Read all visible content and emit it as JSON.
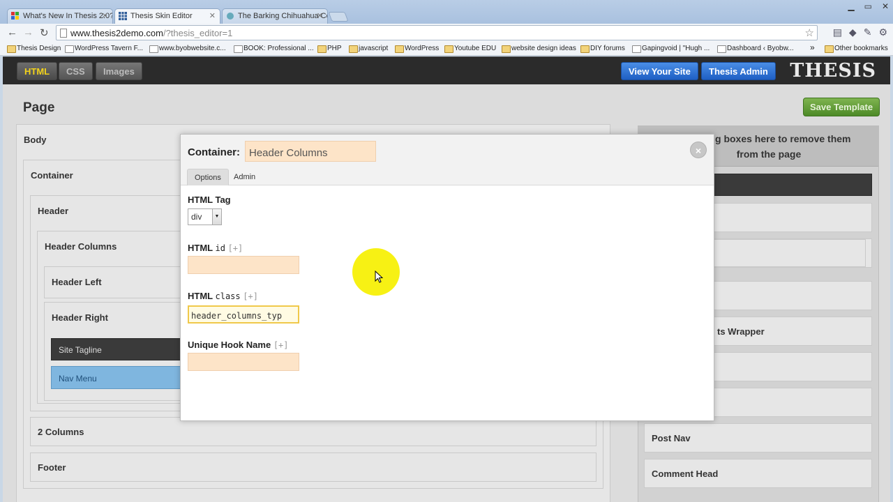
{
  "browser": {
    "tabs": [
      {
        "title": "What's New In Thesis 2.0?",
        "active": false
      },
      {
        "title": "Thesis Skin Editor",
        "active": true
      },
      {
        "title": "The Barking Chihuahua Co",
        "active": false
      }
    ],
    "url_host": "www.thesis2demo.com",
    "url_path": "/?thesis_editor=1",
    "bookmarks": [
      "Thesis Design",
      "WordPress Tavern F...",
      "www.byobwebsite.c...",
      "BOOK: Professional ...",
      "PHP",
      "javascript",
      "WordPress",
      "Youtube EDU",
      "website design ideas",
      "DIY forums",
      "Gapingvoid | \"Hugh ...",
      "Dashboard ‹ Byobw..."
    ],
    "other_bookmarks": "Other bookmarks",
    "overflow": "»"
  },
  "toolbar": {
    "html": "HTML",
    "css": "CSS",
    "images": "Images",
    "view_site": "View Your Site",
    "thesis_admin": "Thesis Admin",
    "logo": "THESIS"
  },
  "page": {
    "title": "Page",
    "save_template": "Save Template",
    "boxes": {
      "body": "Body",
      "container": "Container",
      "header": "Header",
      "header_columns": "Header Columns",
      "header_left": "Header Left",
      "header_right": "Header Right",
      "site_tagline": "Site Tagline",
      "nav_menu": "Nav Menu",
      "two_columns": "2 Columns",
      "footer": "Footer"
    },
    "trash_line1": "g boxes here to remove them",
    "trash_line2": "from the page",
    "right_items": {
      "wrapper": "ts Wrapper",
      "post_nav": "Post Nav",
      "comment_head": "Comment Head"
    }
  },
  "modal": {
    "title": "Container:",
    "name_value": "Header Columns",
    "close": "×",
    "tabs": {
      "options": "Options",
      "admin": "Admin"
    },
    "html_tag_label": "HTML Tag",
    "html_tag_value": "div",
    "id_label_a": "HTML",
    "id_label_code": "id",
    "class_label_a": "HTML",
    "class_label_code": "class",
    "hook_label": "Unique Hook Name",
    "plus": "[+]",
    "id_value": "",
    "class_value": "header_columns_typ",
    "hook_value": ""
  }
}
